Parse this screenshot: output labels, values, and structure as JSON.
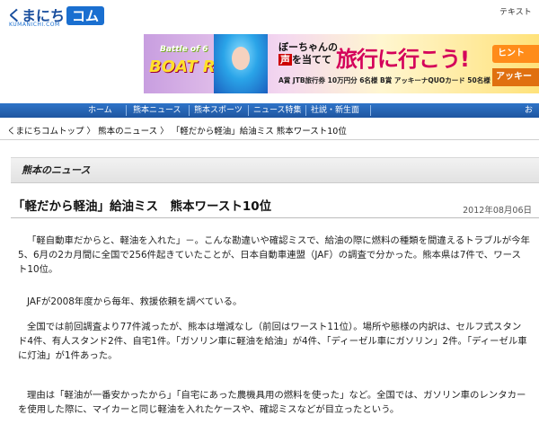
{
  "header": {
    "logo_text": "くまにち",
    "logo_com": "コム",
    "logo_sub": "KUMANICHI.COM",
    "text_link": "テキスト"
  },
  "banner": {
    "top": "Battle of 6",
    "race": "BOAT RACE",
    "voice_line1": "ぼーちゃんの",
    "voice_highlight": "声",
    "voice_line2": "を当てて",
    "trip": "旅行に行こう!",
    "prizes": "A賞 JTB旅行券 10万円分 6名様  B賞 アッキーナQUOカード 50名様",
    "hint": "ヒント",
    "hint2": "アッキー"
  },
  "nav": {
    "items": [
      "ホーム",
      "熊本ニュース",
      "熊本スポーツ",
      "ニュース特集",
      "社説・新生面",
      "お"
    ]
  },
  "breadcrumb": {
    "home": "くまにちコムトップ",
    "sep": "〉",
    "news": "熊本のニュース",
    "current": "「軽だから軽油」給油ミス 熊本ワースト10位"
  },
  "section": {
    "title": "熊本のニュース"
  },
  "article": {
    "headline": "「軽だから軽油」給油ミス　熊本ワースト10位",
    "date": "2012年08月06日",
    "p1": "「軽自動車だからと、軽油を入れた」－。こんな勘違いや確認ミスで、給油の際に燃料の種類を間違えるトラブルが今年5、6月の2カ月間に全国で256件起きていたことが、日本自動車連盟（JAF）の調査で分かった。熊本県は7件で、ワースト10位。",
    "p2": "JAFが2008年度から毎年、救援依頼を調べている。",
    "p3": "全国では前回調査より77件減ったが、熊本は増減なし（前回はワースト11位）。場所や態様の内訳は、セルフ式スタンド4件、有人スタンド2件、自宅1件。「ガソリン車に軽油を給油」が4件、「ディーゼル車にガソリン」2件。「ディーゼル車に灯油」が1件あった。",
    "p4": "理由は「軽油が一番安かったから」「自宅にあった農機具用の燃料を使った」など。全国では、ガソリン車のレンタカーを使用した際に、マイカーと同じ軽油を入れたケースや、確認ミスなどが目立ったという。"
  },
  "colors": {
    "nav_blue": "#1e55a0",
    "logo_blue": "#1a6fd0",
    "trip_pink": "#d4005a"
  }
}
